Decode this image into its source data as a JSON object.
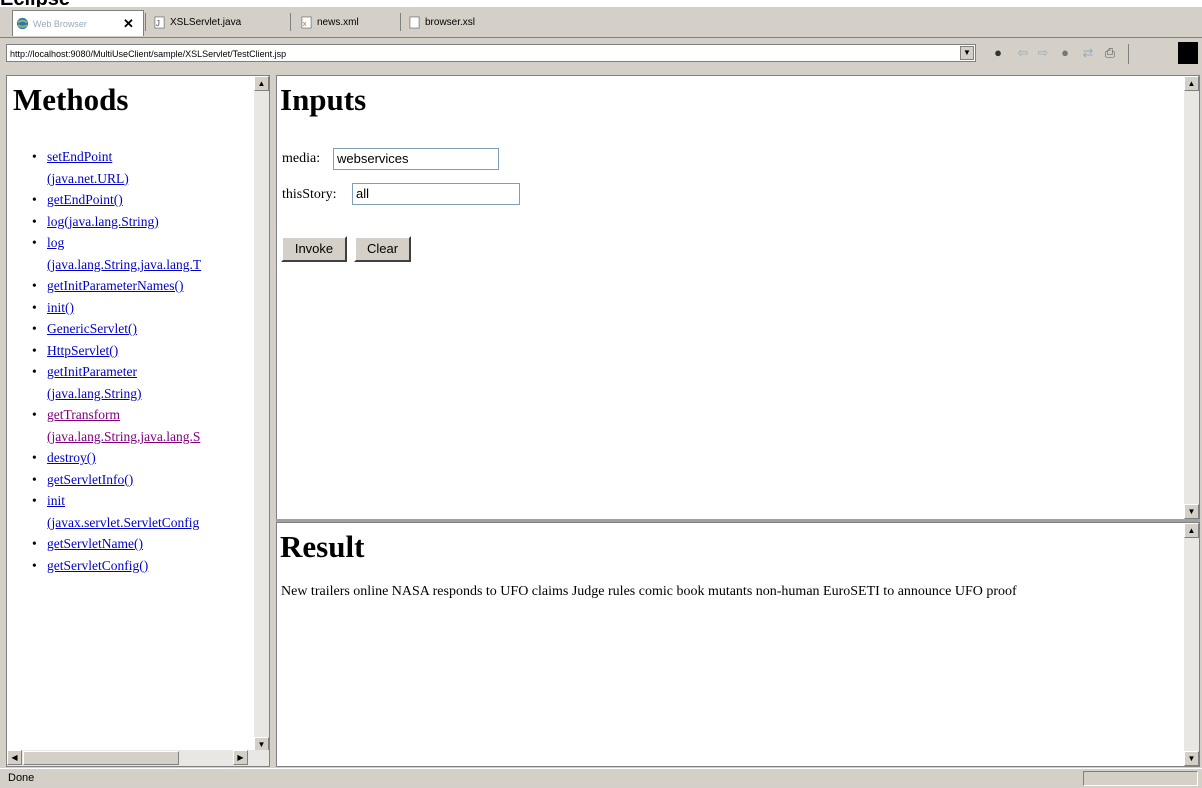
{
  "tabs": [
    {
      "label": "Web Browser",
      "active": true
    },
    {
      "label": "XSLServlet.java",
      "active": false
    },
    {
      "label": "news.xml",
      "active": false
    },
    {
      "label": "browser.xsl",
      "active": false
    }
  ],
  "tab_close": "✕",
  "address": {
    "url": "http://localhost:9080/MultiUseClient/sample/XSLServlet/TestClient.jsp"
  },
  "toolbar": {
    "icons": [
      "go-icon",
      "back-icon",
      "forward-icon",
      "stop-icon",
      "refresh-icon",
      "print-icon"
    ]
  },
  "methods_frame": {
    "title": "Methods",
    "items": [
      {
        "label": "setEndPoint",
        "sub": "(java.net.URL)",
        "visited": false
      },
      {
        "label": "getEndPoint()",
        "sub": "",
        "visited": false
      },
      {
        "label": "log(java.lang.String)",
        "sub": "",
        "visited": false
      },
      {
        "label": "log",
        "sub": "(java.lang.String,java.lang.T",
        "visited": false
      },
      {
        "label": "getInitParameterNames()",
        "sub": "",
        "visited": false
      },
      {
        "label": "init()",
        "sub": "",
        "visited": false
      },
      {
        "label": "GenericServlet()",
        "sub": "",
        "visited": false
      },
      {
        "label": "HttpServlet()",
        "sub": "",
        "visited": false
      },
      {
        "label": "getInitParameter",
        "sub": "(java.lang.String)",
        "visited": false
      },
      {
        "label": "getTransform",
        "sub": "(java.lang.String,java.lang.S",
        "visited": true
      },
      {
        "label": "destroy()",
        "sub": "",
        "visited": false
      },
      {
        "label": "getServletInfo()",
        "sub": "",
        "visited": false
      },
      {
        "label": "init",
        "sub": "(javax.servlet.ServletConfig",
        "visited": false
      },
      {
        "label": "getServletName()",
        "sub": "",
        "visited": false
      },
      {
        "label": "getServletConfig()",
        "sub": "",
        "visited": false
      }
    ]
  },
  "inputs_frame": {
    "title": "Inputs",
    "fields": [
      {
        "label": "media:",
        "value": "webservices"
      },
      {
        "label": "thisStory:",
        "value": "all"
      }
    ],
    "invoke_label": "Invoke",
    "clear_label": "Clear"
  },
  "result_frame": {
    "title": "Result",
    "text": "New trailers online NASA responds to UFO claims Judge rules comic book mutants non-human EuroSETI to announce UFO proof"
  },
  "status": {
    "text": "Done"
  }
}
